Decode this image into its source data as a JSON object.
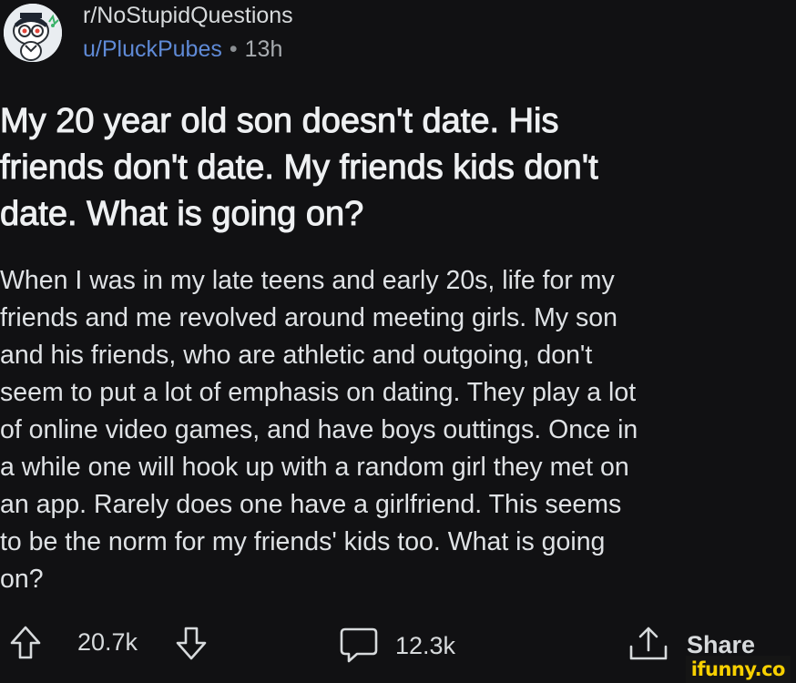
{
  "post": {
    "subreddit": "r/NoStupidQuestions",
    "username": "u/PluckPubes",
    "separator": "•",
    "age": "13h",
    "title": "My 20 year old son doesn't date. His\nfriends don't date. My friends kids don't\ndate. What is going on?",
    "body": "When I was in my late teens and early 20s, life for my\nfriends and me revolved around meeting girls. My son\nand his friends, who are athletic and outgoing, don't\nseem to put a lot of emphasis on dating. They play a lot\nof online video games, and have boys outtings. Once in\na while one will hook up with a random girl they met on\nan app.  Rarely does one have a girlfriend. This seems\nto be the norm for my friends' kids too.  What is going\non?"
  },
  "actions": {
    "upvote_icon": "upvote-arrow-icon",
    "vote_count": "20.7k",
    "downvote_icon": "downvote-arrow-icon",
    "comment_icon": "comment-bubble-icon",
    "comment_count": "12.3k",
    "share_icon": "share-upload-icon",
    "share_label": "Share"
  },
  "watermark": {
    "text": "ifunny.co"
  },
  "colors": {
    "background": "#111113",
    "username": "#5f8ad6",
    "text": "#e6e8ea",
    "watermark": "#f7d000"
  }
}
